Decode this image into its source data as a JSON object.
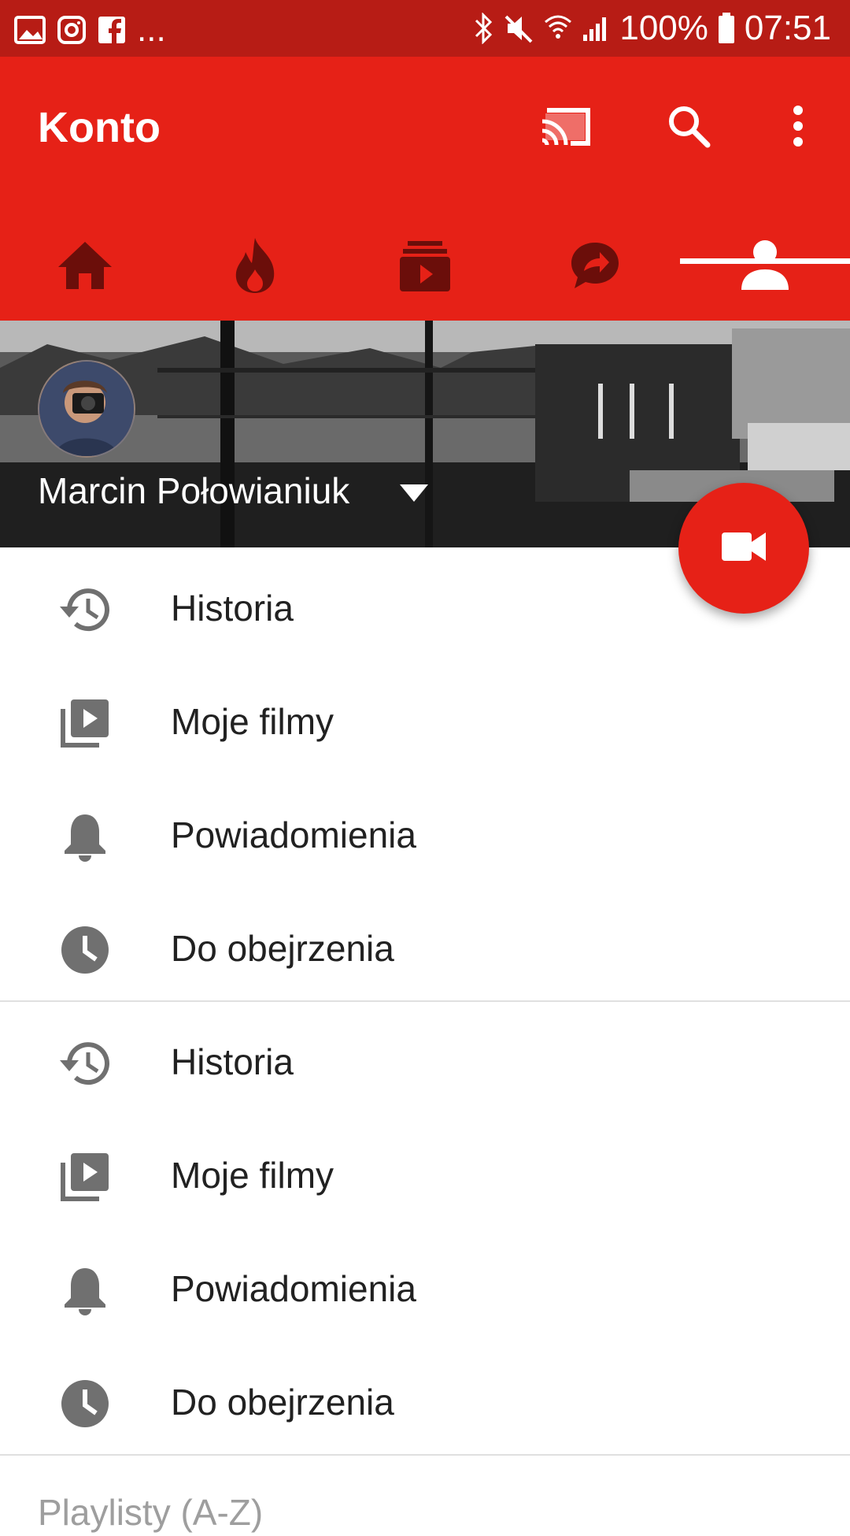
{
  "status_bar": {
    "battery": "100%",
    "time": "07:51",
    "notification_icons": [
      "image-icon",
      "instagram-icon",
      "facebook-icon",
      "more-icon"
    ],
    "system_icons": [
      "bluetooth-icon",
      "mute-icon",
      "wifi-icon",
      "signal-icon",
      "battery-icon"
    ],
    "overflow_text": "..."
  },
  "app_bar": {
    "title": "Konto",
    "actions": [
      "cast-icon",
      "search-icon",
      "more-vert-icon"
    ],
    "background_color": "#e62117"
  },
  "tabs": [
    {
      "icon": "home-icon",
      "active": false
    },
    {
      "icon": "trending-icon",
      "active": false
    },
    {
      "icon": "subscriptions-icon",
      "active": false
    },
    {
      "icon": "shared-icon",
      "active": false
    },
    {
      "icon": "account-icon",
      "active": true
    }
  ],
  "account": {
    "name": "Marcin Połowianiuk"
  },
  "fab": {
    "icon": "videocam-icon"
  },
  "list_section_1": [
    {
      "icon": "history-icon",
      "label": "Historia"
    },
    {
      "icon": "my-videos-icon",
      "label": "Moje filmy"
    },
    {
      "icon": "notifications-icon",
      "label": "Powiadomienia"
    },
    {
      "icon": "watch-later-icon",
      "label": "Do obejrzenia"
    }
  ],
  "list_section_2": [
    {
      "icon": "history-icon",
      "label": "Historia"
    },
    {
      "icon": "my-videos-icon",
      "label": "Moje filmy"
    },
    {
      "icon": "notifications-icon",
      "label": "Powiadomienia"
    },
    {
      "icon": "watch-later-icon",
      "label": "Do obejrzenia"
    }
  ],
  "playlists_header": "Playlisty (A-Z)"
}
